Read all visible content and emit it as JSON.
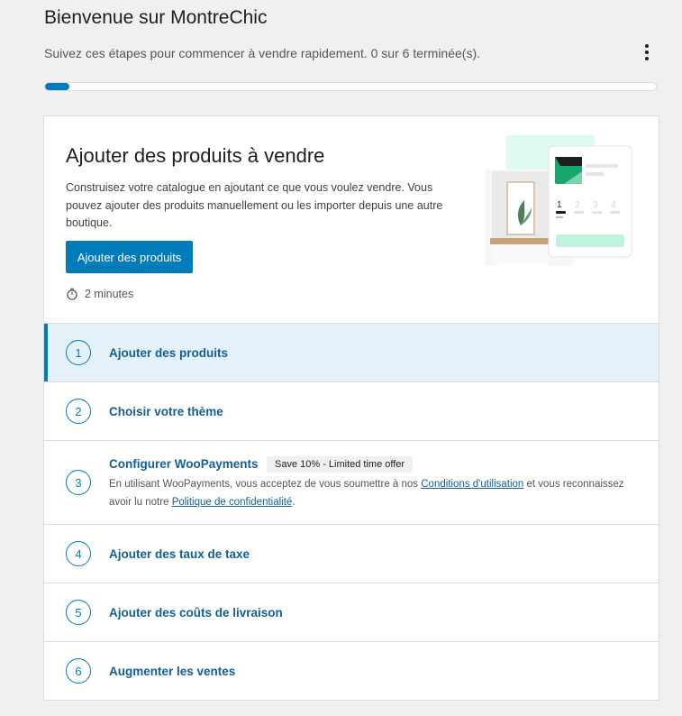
{
  "header": {
    "title": "Bienvenue sur MontreChic",
    "subtitle": "Suivez ces étapes pour commencer à vendre rapidement. 0 sur 6 terminée(s).",
    "progress": {
      "completed": 0,
      "total": 6,
      "fraction": 0.04
    },
    "more_icon": "more-vertical-icon"
  },
  "hero": {
    "title": "Ajouter des produits à vendre",
    "description": "Construisez votre catalogue en ajoutant ce que vous voulez vendre. Vous pouvez ajouter des produits manuellement ou les importer depuis une autre boutique.",
    "button_label": "Ajouter des produits",
    "time_icon": "timer-icon",
    "time": "2 minutes",
    "illustration_steps": [
      "1",
      "2",
      "3",
      "4"
    ]
  },
  "steps": [
    {
      "number": "1",
      "label": "Ajouter des produits",
      "active": true
    },
    {
      "number": "2",
      "label": "Choisir votre thème"
    },
    {
      "number": "3",
      "label": "Configurer WooPayments",
      "badge": "Save 10% - Limited time offer",
      "note_prefix": "En utilisant WooPayments, vous acceptez de vous soumettre à nos ",
      "note_link1": "Conditions d'utilisation",
      "note_middle": " et vous reconnaissez avoir lu notre ",
      "note_link2": "Politique de confidentialité",
      "note_suffix": "."
    },
    {
      "number": "4",
      "label": "Ajouter des taux de taxe"
    },
    {
      "number": "5",
      "label": "Ajouter des coûts de livraison"
    },
    {
      "number": "6",
      "label": "Augmenter les ventes"
    }
  ],
  "colors": {
    "accent": "#007cba",
    "link": "#135e96",
    "active_bg": "#e5f1f8",
    "background": "#f0f0f1"
  }
}
